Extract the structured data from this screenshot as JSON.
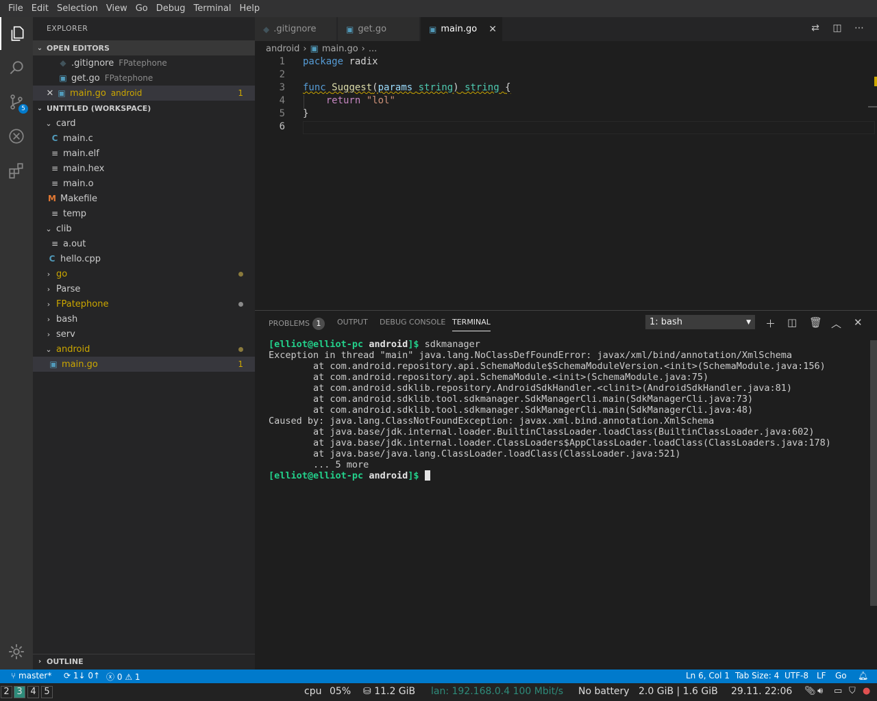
{
  "menu": [
    "File",
    "Edit",
    "Selection",
    "View",
    "Go",
    "Debug",
    "Terminal",
    "Help"
  ],
  "activity": {
    "scm_badge": "5"
  },
  "explorer": {
    "title": "EXPLORER",
    "open_editors": {
      "title": "OPEN EDITORS",
      "items": [
        {
          "name": ".gitignore",
          "desc": "FPatephone"
        },
        {
          "name": "get.go",
          "desc": "FPatephone"
        },
        {
          "name": "main.go",
          "desc": "android",
          "count": "1"
        }
      ]
    },
    "workspace": {
      "title": "UNTITLED (WORKSPACE)",
      "items": [
        "card",
        "main.c",
        "main.elf",
        "main.hex",
        "main.o",
        "Makefile",
        "temp",
        "clib",
        "a.out",
        "hello.cpp",
        "go",
        "Parse",
        "FPatephone",
        "bash",
        "serv",
        "android",
        "main.go"
      ],
      "main_go_count": "1"
    },
    "outline": "OUTLINE"
  },
  "tabs": [
    ".gitignore",
    "get.go",
    "main.go"
  ],
  "breadcrumb": {
    "folder": "android",
    "file": "main.go",
    "more": "..."
  },
  "editor": {
    "line_numbers": [
      "1",
      "2",
      "3",
      "4",
      "5",
      "6"
    ],
    "code": {
      "l1_kw": "package",
      "l1_name": "radix",
      "l3_kw": "func",
      "l3_fn": "Suggest",
      "l3_open": "(",
      "l3_param": "params",
      "l3_type": "string",
      "l3_close": ")",
      "l3_ret": "string",
      "l3_brace": "{",
      "l4_kw": "return",
      "l4_str": "\"lol\"",
      "l5": "}"
    }
  },
  "panel": {
    "tabs": {
      "problems": "PROBLEMS",
      "problems_count": "1",
      "output": "OUTPUT",
      "debug": "DEBUG CONSOLE",
      "terminal": "TERMINAL"
    },
    "terminal_select": "1: bash",
    "prompt_user": "[elliot@elliot-pc",
    "prompt_dir": "android",
    "prompt_end": "]$",
    "command": "sdkmanager",
    "lines": [
      "Exception in thread \"main\" java.lang.NoClassDefFoundError: javax/xml/bind/annotation/XmlSchema",
      "        at com.android.repository.api.SchemaModule$SchemaModuleVersion.<init>(SchemaModule.java:156)",
      "        at com.android.repository.api.SchemaModule.<init>(SchemaModule.java:75)",
      "        at com.android.sdklib.repository.AndroidSdkHandler.<clinit>(AndroidSdkHandler.java:81)",
      "        at com.android.sdklib.tool.sdkmanager.SdkManagerCli.main(SdkManagerCli.java:73)",
      "        at com.android.sdklib.tool.sdkmanager.SdkManagerCli.main(SdkManagerCli.java:48)",
      "Caused by: java.lang.ClassNotFoundException: javax.xml.bind.annotation.XmlSchema",
      "        at java.base/jdk.internal.loader.BuiltinClassLoader.loadClass(BuiltinClassLoader.java:602)",
      "        at java.base/jdk.internal.loader.ClassLoaders$AppClassLoader.loadClass(ClassLoaders.java:178)",
      "        at java.base/java.lang.ClassLoader.loadClass(ClassLoader.java:521)",
      "        ... 5 more"
    ]
  },
  "status": {
    "branch": "master*",
    "sync": "1↓ 0↑",
    "errors": "0",
    "warnings": "1",
    "position": "Ln 6, Col 1",
    "tab_size": "Tab Size: 4",
    "encoding": "UTF-8",
    "eol": "LF",
    "language": "Go"
  },
  "system": {
    "workspaces": [
      "2",
      "3",
      "4",
      "5"
    ],
    "cpu_label": "cpu",
    "cpu": "05%",
    "disk": "11.2 GiB",
    "lan": "lan: 192.168.0.4 100 Mbit/s",
    "battery": "No battery",
    "mem": "2.0 GiB | 1.6 GiB",
    "datetime": "29.11. 22:06"
  },
  "colors": {
    "accent": "#007acc",
    "modified": "#cca700",
    "prompt": "#23d18b"
  }
}
